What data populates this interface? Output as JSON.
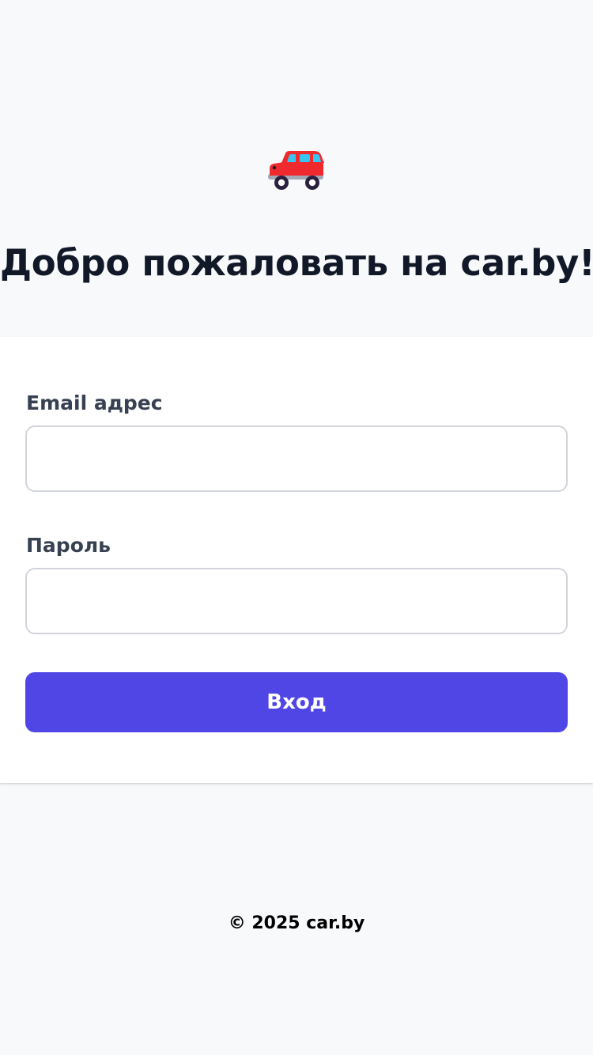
{
  "header": {
    "logo_icon": "red-car-icon",
    "title": "Добро пожаловать на car.by!"
  },
  "login_form": {
    "email_label": "Email адрес",
    "email_value": "",
    "password_label": "Пароль",
    "password_value": "",
    "submit_label": "Вход"
  },
  "footer": {
    "copyright": "© 2025 car.by"
  },
  "colors": {
    "page_background": "#f8f9fb",
    "card_background": "#ffffff",
    "title_text": "#111827",
    "label_text": "#374151",
    "input_border": "#d1d5db",
    "primary_button": "#4f46e5",
    "car_body": "#f0292e",
    "car_window": "#38c5f2"
  }
}
